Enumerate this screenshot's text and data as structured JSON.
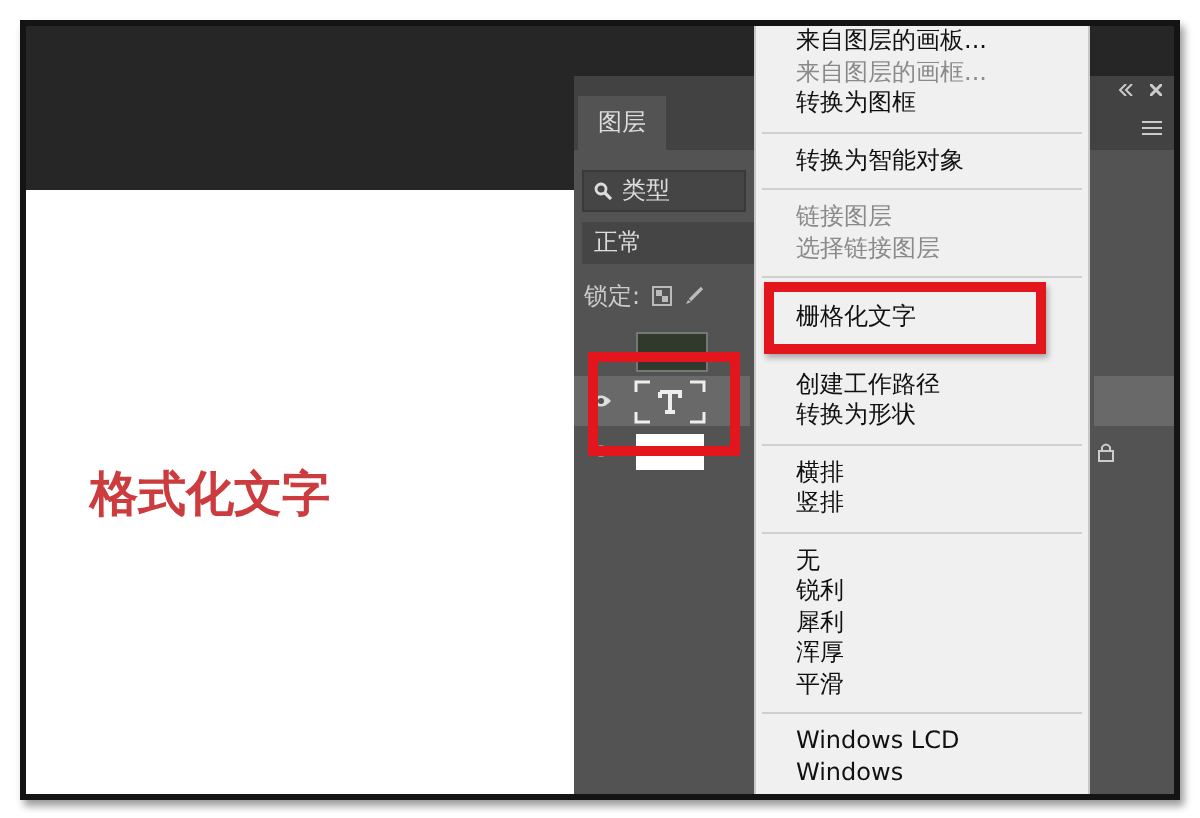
{
  "canvas": {
    "text": "格式化文字"
  },
  "layers_panel": {
    "tabs": [
      {
        "label": "图层",
        "selected": true
      }
    ],
    "filter": {
      "label": "类型"
    },
    "blend_mode": {
      "value": "正常"
    },
    "lock": {
      "label": "锁定:"
    },
    "layers": [
      {
        "kind": "image",
        "visible": false,
        "selected": false,
        "locked": false
      },
      {
        "kind": "text",
        "visible": true,
        "selected": true,
        "locked": false
      },
      {
        "kind": "background",
        "visible": true,
        "selected": false,
        "locked": true
      }
    ]
  },
  "context_menu": {
    "groups": [
      [
        {
          "label": "来自图层的画板...",
          "disabled": false
        },
        {
          "label": "来自图层的画框...",
          "disabled": true
        },
        {
          "label": "转换为图框",
          "disabled": false
        }
      ],
      [
        {
          "label": "转换为智能对象",
          "disabled": false
        }
      ],
      [
        {
          "label": "链接图层",
          "disabled": true
        },
        {
          "label": "选择链接图层",
          "disabled": true
        }
      ],
      [
        {
          "label": "栅格化文字",
          "disabled": false
        },
        {
          "label": "创建工作路径",
          "disabled": false
        },
        {
          "label": "转换为形状",
          "disabled": false
        }
      ],
      [
        {
          "label": "横排",
          "disabled": false
        },
        {
          "label": "竖排",
          "disabled": false
        }
      ],
      [
        {
          "label": "无",
          "disabled": false
        },
        {
          "label": "锐利",
          "disabled": false
        },
        {
          "label": "犀利",
          "disabled": false
        },
        {
          "label": "浑厚",
          "disabled": false
        },
        {
          "label": "平滑",
          "disabled": false
        }
      ],
      [
        {
          "label": "Windows LCD",
          "disabled": false
        },
        {
          "label": "Windows",
          "disabled": false
        }
      ]
    ]
  }
}
